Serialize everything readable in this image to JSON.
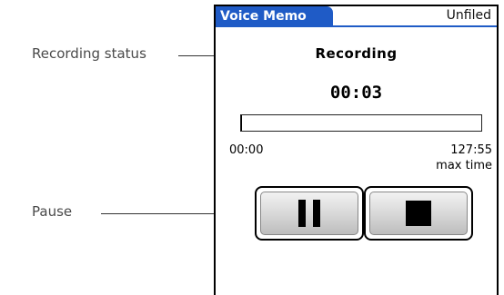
{
  "app": {
    "title": "Voice Memo",
    "category": "Unfiled"
  },
  "recorder": {
    "status": "Recording",
    "elapsed": "00:03",
    "progress_fraction": 0.0004,
    "start_time": "00:00",
    "max_time_value": "127:55",
    "max_time_label": "max time"
  },
  "controls": {
    "pause_icon": "pause-icon",
    "stop_icon": "stop-icon"
  },
  "callouts": {
    "recording_status": "Recording status",
    "pause": "Pause"
  },
  "colors": {
    "title_bar": "#1f5bc6",
    "progress": "#000000"
  }
}
